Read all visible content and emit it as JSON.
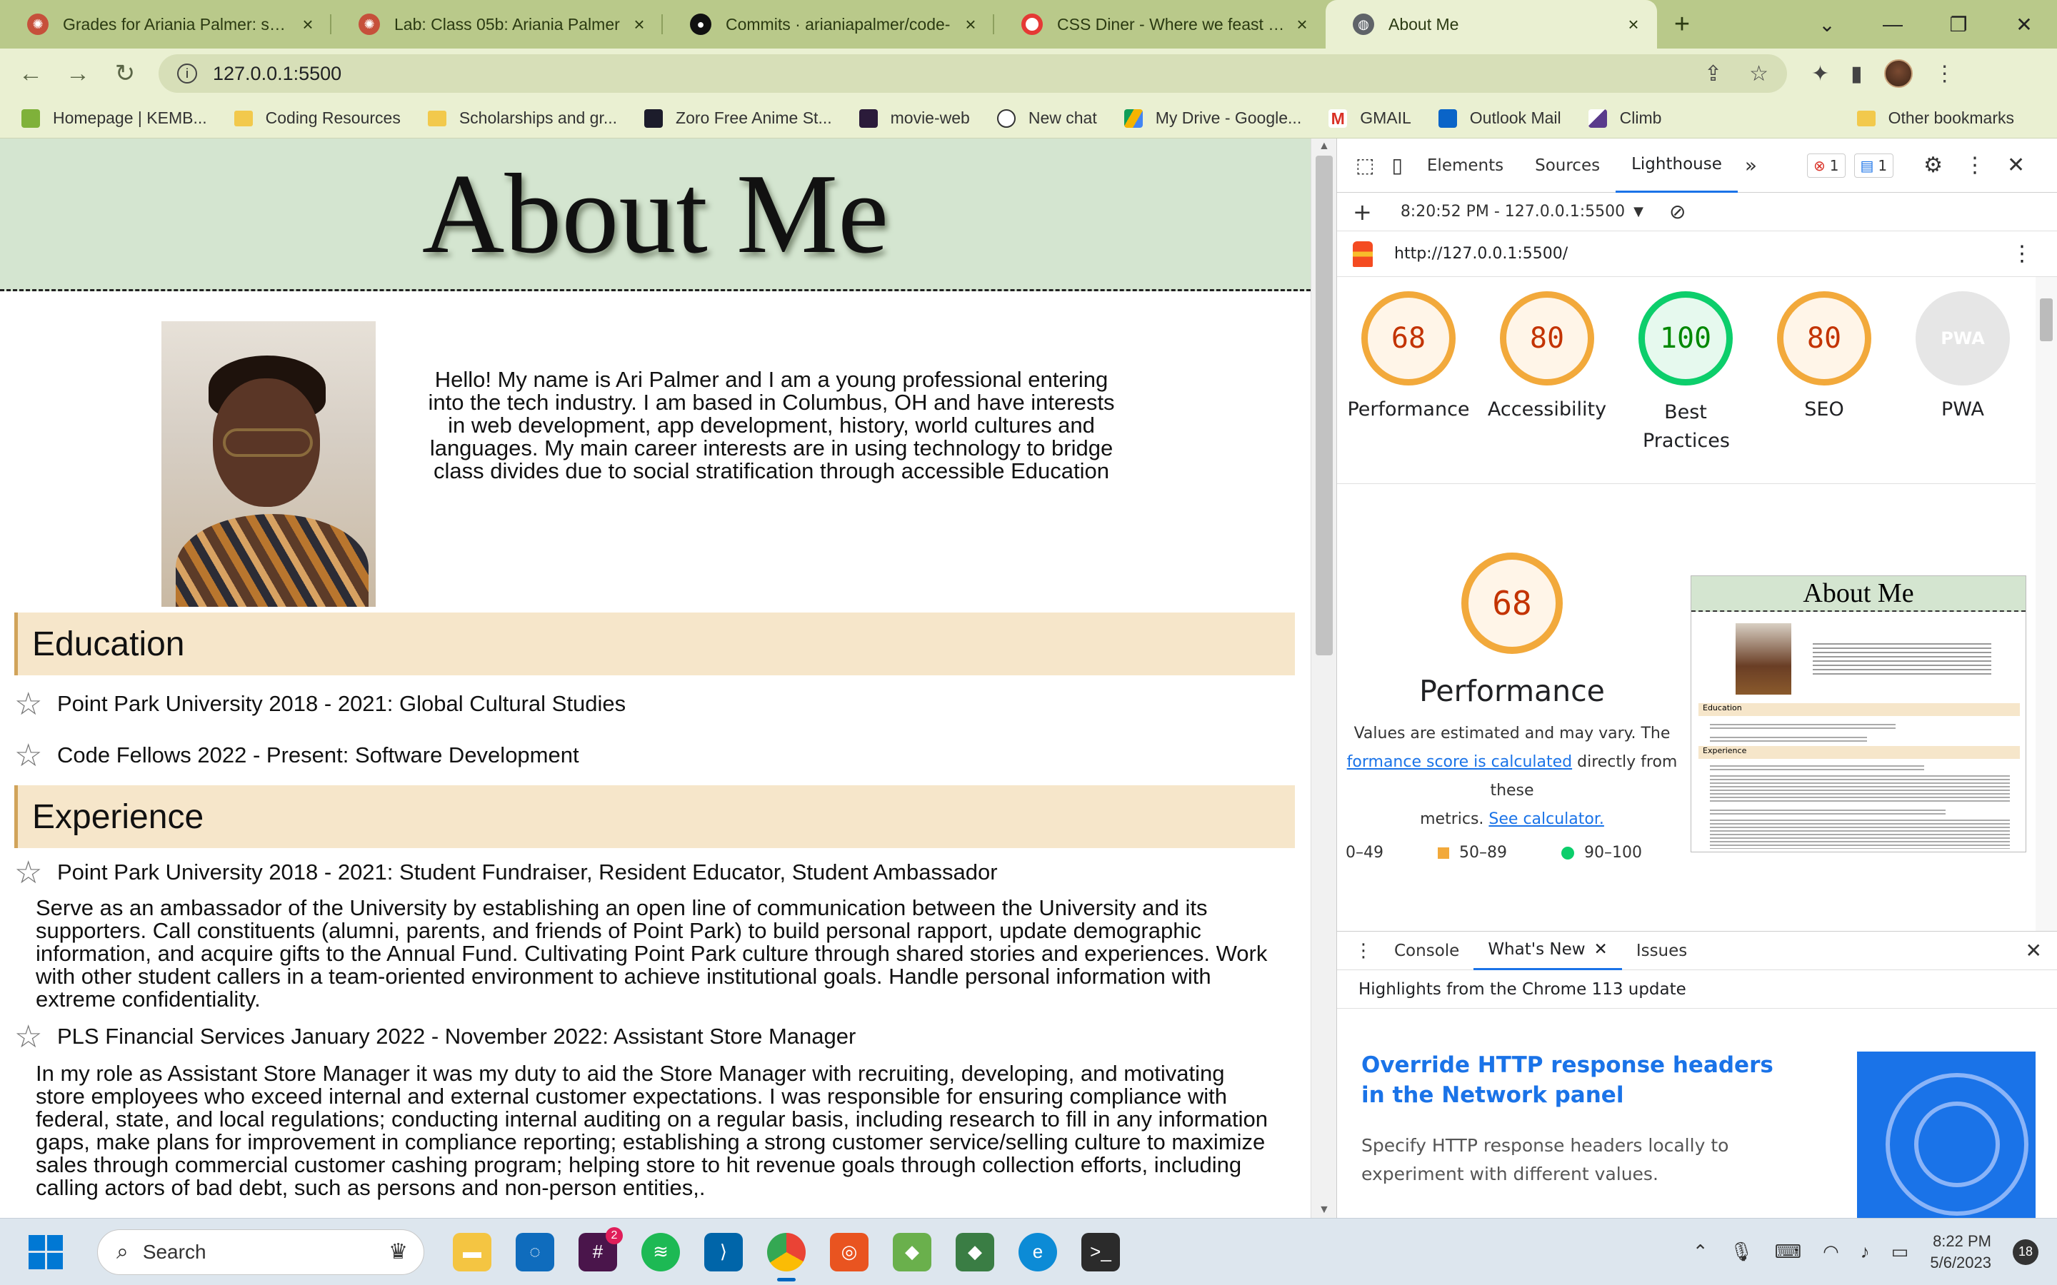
{
  "browser": {
    "tabs": [
      {
        "title": "Grades for Ariania Palmer: seatt",
        "favicon": "canvas-icon",
        "color": "#c6503b"
      },
      {
        "title": "Lab: Class 05b: Ariania Palmer",
        "favicon": "canvas-icon",
        "color": "#c6503b"
      },
      {
        "title": "Commits · arianiapalmer/code-",
        "favicon": "github-icon",
        "color": "#111111"
      },
      {
        "title": "CSS Diner - Where we feast on",
        "favicon": "css-diner-icon",
        "color": "#e53935"
      },
      {
        "title": "About Me",
        "favicon": "globe-icon",
        "color": "#5f6368"
      }
    ],
    "url": "127.0.0.1:5500",
    "bookmarks": [
      "Homepage | KEMB...",
      "Coding Resources",
      "Scholarships and gr...",
      "Zoro Free Anime St...",
      "movie-web",
      "New chat",
      "My Drive - Google...",
      "GMAIL",
      "Outlook Mail",
      "Climb"
    ],
    "other_bookmarks": "Other bookmarks"
  },
  "page": {
    "title": "About Me",
    "intro": "Hello! My name is Ari Palmer and I am a young professional entering into the tech industry. I am based in Columbus, OH and have interests in web development, app development, history, world cultures and languages. My main career interests are in using technology to bridge class divides due to social stratification through accessible Education",
    "education_heading": "Education",
    "education": [
      "Point Park University 2018 - 2021: Global Cultural Studies",
      "Code Fellows 2022 - Present: Software Development"
    ],
    "experience_heading": "Experience",
    "experience": [
      {
        "title": "Point Park University 2018 - 2021: Student Fundraiser, Resident Educator, Student Ambassador",
        "description": "Serve as an ambassador of the University by establishing an open line of communication between the University and its supporters. Call constituents (alumni, parents, and friends of Point Park) to build personal rapport, update demographic information, and acquire gifts to the Annual Fund. Cultivating Point Park culture through shared stories and experiences. Work with other student callers in a team-oriented environment to achieve institutional goals. Handle personal information with extreme confidentiality."
      },
      {
        "title": "PLS Financial Services January 2022 - November 2022: Assistant Store Manager",
        "description": "In my role as Assistant Store Manager it was my duty to aid the Store Manager with recruiting, developing, and motivating store employees who exceed internal and external customer expectations. I was responsible for ensuring compliance with federal, state, and local regulations; conducting internal auditing on a regular basis, including research to fill in any information gaps, make plans for improvement in compliance reporting; establishing a strong customer service/selling culture to maximize sales through commercial customer cashing program; helping store to hit revenue goals through collection efforts, including calling actors of bad debt, such as persons and non-person entities,."
      }
    ]
  },
  "devtools": {
    "tabs": [
      "Elements",
      "Sources",
      "Lighthouse"
    ],
    "active_tab": "Lighthouse",
    "errors": "1",
    "messages": "1",
    "report_time": "8:20:52 PM - 127.0.0.1:5500",
    "report_url": "http://127.0.0.1:5500/",
    "scores": [
      {
        "label": "Performance",
        "value": "68",
        "status": "orange"
      },
      {
        "label": "Accessibility",
        "value": "80",
        "status": "orange"
      },
      {
        "label": "Best Practices",
        "value": "100",
        "status": "green"
      },
      {
        "label": "SEO",
        "value": "80",
        "status": "orange"
      },
      {
        "label": "PWA",
        "value": "PWA",
        "status": "grey"
      }
    ],
    "perf_score": "68",
    "perf_title": "Performance",
    "perf_note_1": "Values are estimated and may vary. The",
    "perf_link_1": "formance score is calculated",
    "perf_note_2": "directly from these",
    "perf_note_3": "metrics.",
    "perf_link_2": "See calculator.",
    "legend": [
      "0–49",
      "50–89",
      "90–100"
    ],
    "thumb_title": "About Me",
    "thumb_education": "Education",
    "thumb_experience": "Experience",
    "drawer_tabs": [
      "Console",
      "What's New",
      "Issues"
    ],
    "drawer_active": "What's New",
    "highlights": "Highlights from the Chrome 113 update",
    "feature_title": "Override HTTP response headers in the Network panel",
    "feature_desc": "Specify HTTP response headers locally to experiment with different values."
  },
  "taskbar": {
    "search_placeholder": "Search",
    "slack_badge": "2",
    "time": "8:22 PM",
    "date": "5/6/2023",
    "notifications": "18"
  },
  "colors": {
    "accent": "#1a73e8",
    "score_orange": "#f2a93b",
    "score_green": "#0cce6b",
    "header_green": "#d4e5d0",
    "section_bg": "#f6e6ca"
  }
}
